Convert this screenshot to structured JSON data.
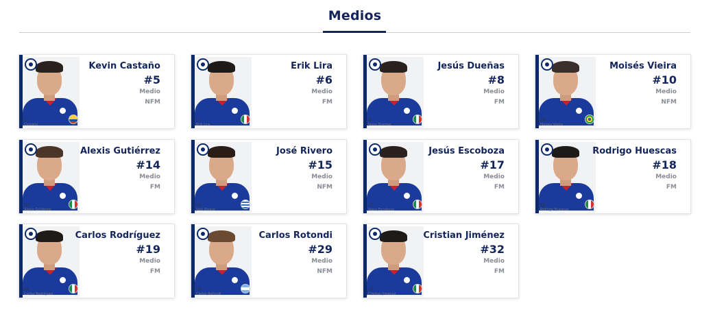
{
  "section": {
    "title": "Medios"
  },
  "players": [
    {
      "name": "Kevin Castaño",
      "number": "#5",
      "position": "Medio",
      "status": "NFM",
      "photo_number": "5",
      "photo_name": "Castaño",
      "flag": "flag-col"
    },
    {
      "name": "Erik Lira",
      "number": "#6",
      "position": "Medio",
      "status": "FM",
      "photo_number": "6",
      "photo_name": "Erik Lira",
      "flag": "flag-mex"
    },
    {
      "name": "Jesús Dueñas",
      "number": "#8",
      "position": "Medio",
      "status": "FM",
      "photo_number": "8",
      "photo_name": "Jesús Dueñas",
      "flag": "flag-mex"
    },
    {
      "name": "Moisés Vieira",
      "number": "#10",
      "position": "Medio",
      "status": "NFM",
      "photo_number": "10",
      "photo_name": "Moisés Vieira",
      "flag": "flag-bra"
    },
    {
      "name": "Alexis Gutiérrez",
      "number": "#14",
      "position": "Medio",
      "status": "FM",
      "photo_number": "14",
      "photo_name": "Alexis Gutiérrez",
      "flag": "flag-mex"
    },
    {
      "name": "José Rivero",
      "number": "#15",
      "position": "Medio",
      "status": "NFM",
      "photo_number": "15",
      "photo_name": "José Rivero",
      "flag": "flag-uru"
    },
    {
      "name": "Jesús Escoboza",
      "number": "#17",
      "position": "Medio",
      "status": "FM",
      "photo_number": "17",
      "photo_name": "Jesús Escoboza",
      "flag": "flag-mex"
    },
    {
      "name": "Rodrigo Huescas",
      "number": "#18",
      "position": "Medio",
      "status": "FM",
      "photo_number": "18",
      "photo_name": "Rodrigo Huescas",
      "flag": "flag-mex"
    },
    {
      "name": "Carlos Rodríguez",
      "number": "#19",
      "position": "Medio",
      "status": "FM",
      "photo_number": "19",
      "photo_name": "Carlos Rodríguez",
      "flag": "flag-mex"
    },
    {
      "name": "Carlos Rotondi",
      "number": "#29",
      "position": "Medio",
      "status": "NFM",
      "photo_number": "29",
      "photo_name": "Carlos Rotondi",
      "flag": "flag-arg"
    },
    {
      "name": "Cristian Jiménez",
      "number": "#32",
      "position": "Medio",
      "status": "FM",
      "photo_number": "32",
      "photo_name": "Cristian Jiménez",
      "flag": "flag-mex"
    }
  ]
}
